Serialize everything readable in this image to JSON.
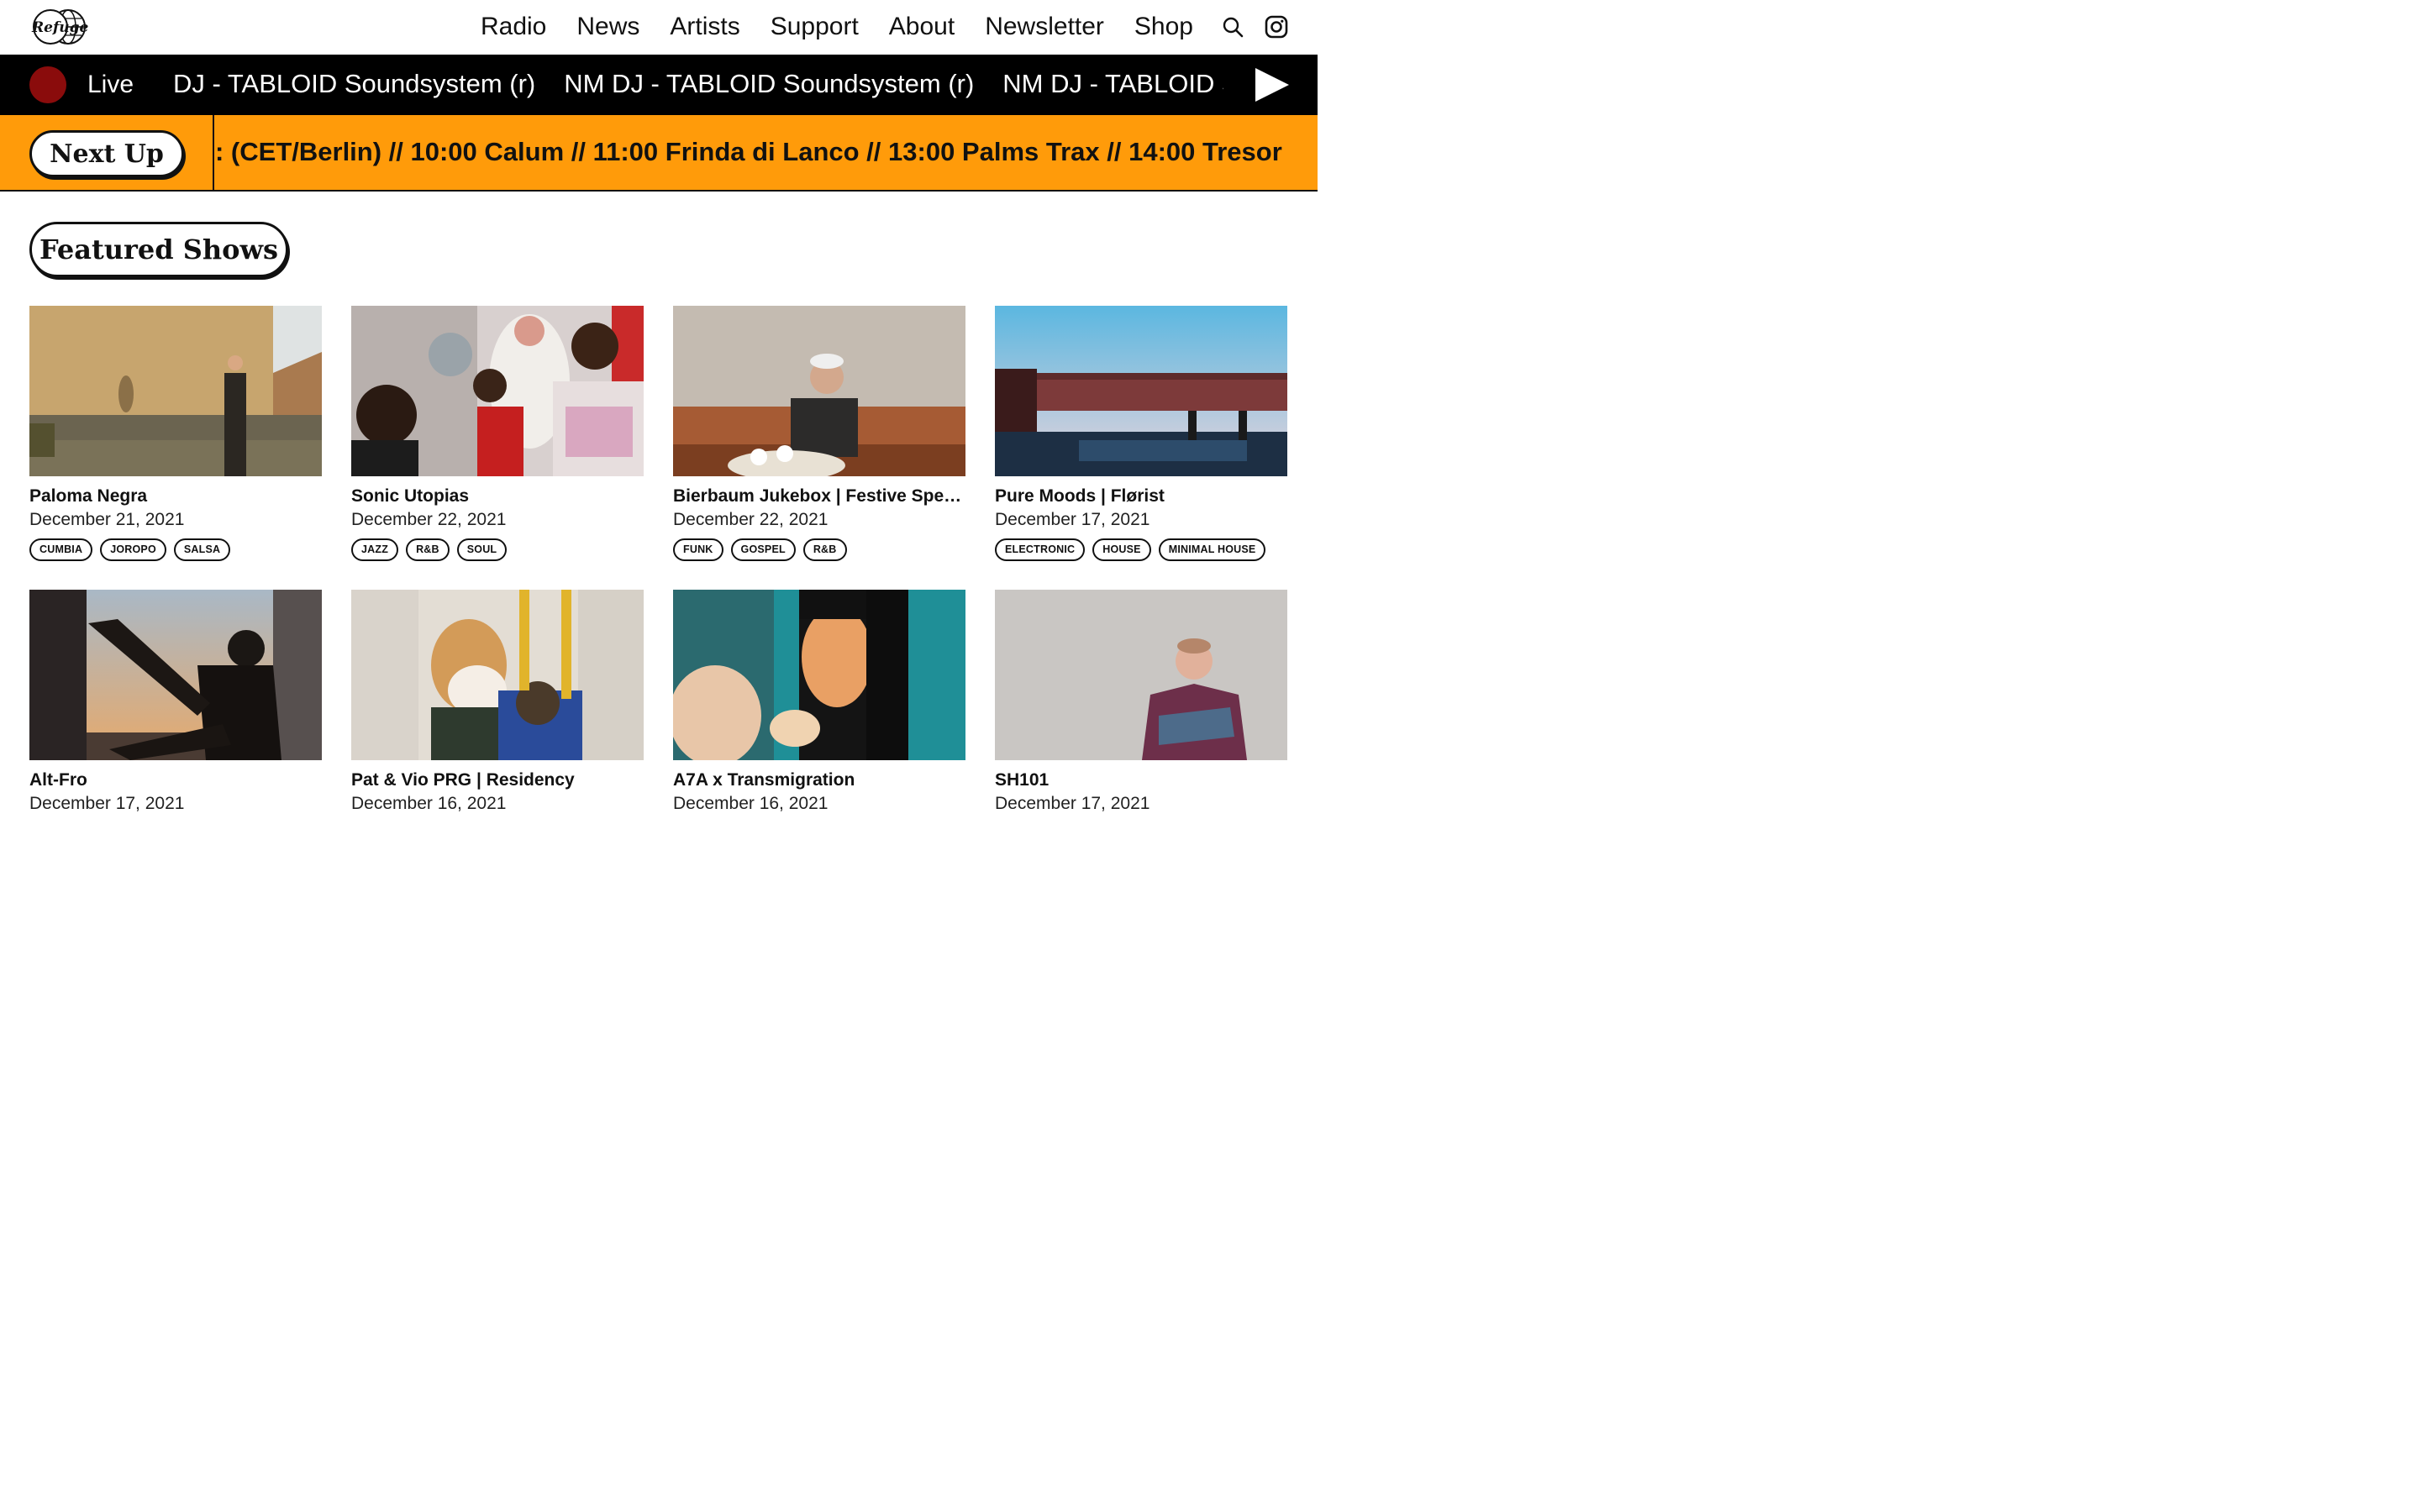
{
  "header": {
    "logo_text": "Refuge",
    "nav": [
      "Radio",
      "News",
      "Artists",
      "Support",
      "About",
      "Newsletter",
      "Shop"
    ],
    "icons": [
      "search-icon",
      "instagram-icon"
    ]
  },
  "live": {
    "label": "Live",
    "ticker": [
      "DJ - TABLOID Soundsystem (r)",
      "NM DJ - TABLOID Soundsystem (r)",
      "NM DJ - TABLOID Sou"
    ],
    "dot_color": "#8a0c0c",
    "play_icon": "play-icon"
  },
  "next_up": {
    "label": "Next Up",
    "ticker": ": (CET/Berlin) // 10:00 Calum // 11:00 Frinda di Lanco // 13:00 Palms Trax // 14:00 Tresor"
  },
  "featured": {
    "heading": "Featured Shows",
    "shows": [
      {
        "title": "Paloma Negra",
        "date": "December 21, 2021",
        "tags": [
          "CUMBIA",
          "JOROPO",
          "SALSA"
        ]
      },
      {
        "title": "Sonic Utopias",
        "date": "December 22, 2021",
        "tags": [
          "JAZZ",
          "R&B",
          "SOUL"
        ]
      },
      {
        "title": "Bierbaum Jukebox | Festive Speci...",
        "date": "December 22, 2021",
        "tags": [
          "FUNK",
          "GOSPEL",
          "R&B"
        ]
      },
      {
        "title": "Pure Moods | Flørist",
        "date": "December 17, 2021",
        "tags": [
          "ELECTRONIC",
          "HOUSE",
          "MINIMAL HOUSE"
        ]
      },
      {
        "title": "Alt-Fro",
        "date": "December 17, 2021",
        "tags": []
      },
      {
        "title": "Pat & Vio PRG | Residency",
        "date": "December 16, 2021",
        "tags": []
      },
      {
        "title": "A7A x Transmigration",
        "date": "December 16, 2021",
        "tags": []
      },
      {
        "title": "SH101",
        "date": "December 17, 2021",
        "tags": []
      }
    ]
  },
  "colors": {
    "accent_orange": "#ff9b0a",
    "live_bar": "#000000",
    "text": "#111111"
  }
}
